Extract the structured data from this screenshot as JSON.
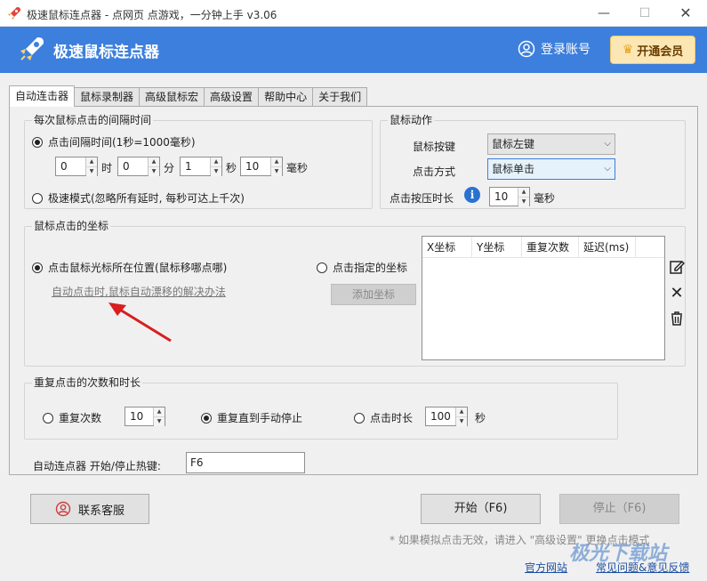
{
  "window": {
    "title": "极速鼠标连点器 - 点网页 点游戏，一分钟上手 v3.06",
    "min": "—",
    "max": "☐",
    "close": "✕"
  },
  "header": {
    "brand": "极速鼠标连点器",
    "login": "登录账号",
    "vip": "开通会员"
  },
  "tabs": [
    "自动连击器",
    "鼠标录制器",
    "高级鼠标宏",
    "高级设置",
    "帮助中心",
    "关于我们"
  ],
  "interval": {
    "group_title": "每次鼠标点击的间隔时间",
    "mode_label": "点击间隔时间(1秒=1000毫秒)",
    "hours": "0",
    "hours_unit": "时",
    "minutes": "0",
    "minutes_unit": "分",
    "seconds": "1",
    "seconds_unit": "秒",
    "ms": "10",
    "ms_unit": "毫秒",
    "fast_mode_label": "极速模式(忽略所有延时, 每秒可达上千次)"
  },
  "action": {
    "group_title": "鼠标动作",
    "button_label": "鼠标按键",
    "button_value": "鼠标左键",
    "method_label": "点击方式",
    "method_value": "鼠标单击",
    "press_label": "点击按压时长",
    "press_value": "10",
    "press_unit": "毫秒"
  },
  "coords": {
    "group_title": "鼠标点击的坐标",
    "cursor_label": "点击鼠标光标所在位置(鼠标移哪点哪)",
    "drift_link": "自动点击时,鼠标自动漂移的解决办法",
    "specified_label": "点击指定的坐标",
    "add_button": "添加坐标",
    "columns": [
      "X坐标",
      "Y坐标",
      "重复次数",
      "延迟(ms)"
    ]
  },
  "repeat": {
    "group_title": "重复点击的次数和时长",
    "count_label": "重复次数",
    "count_value": "10",
    "until_stop_label": "重复直到手动停止",
    "duration_label": "点击时长",
    "duration_value": "100",
    "duration_unit": "秒"
  },
  "hotkey": {
    "label": "自动连点器 开始/停止热键:",
    "value": "F6"
  },
  "footer": {
    "support": "联系客服",
    "start": "开始（F6)",
    "stop": "停止（F6)",
    "note": "* 如果模拟点击无效，请进入 \"高级设置\" 更换点击模式",
    "official_site": "官方网站",
    "faq": "常见问题&意见反馈",
    "watermark": "极光下载站"
  },
  "colors": {
    "header": "#3d7fdc",
    "vip_bg": "#fce7b4",
    "arrow": "#d81e1e"
  }
}
